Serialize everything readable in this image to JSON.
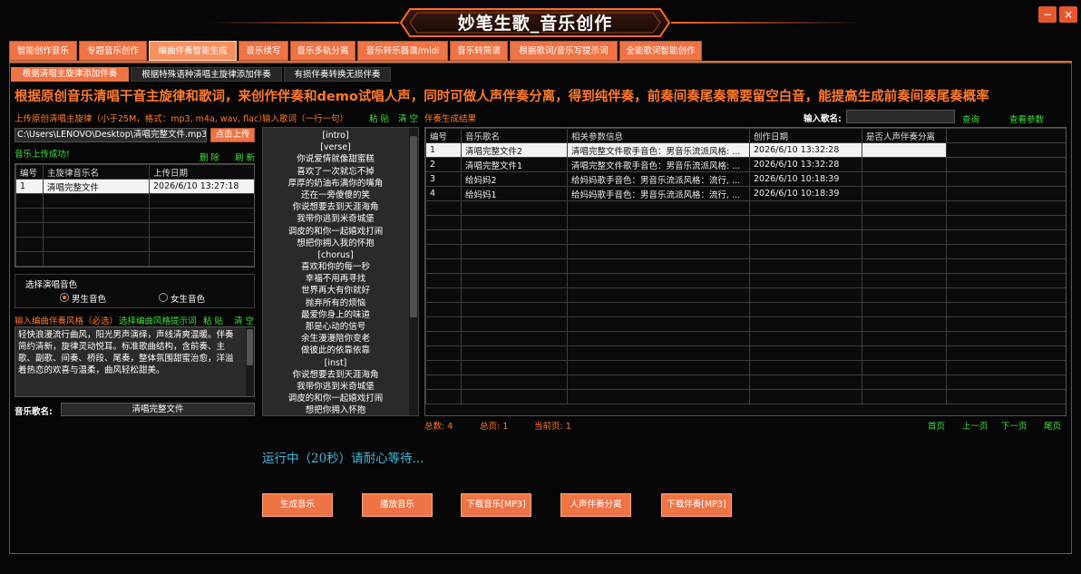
{
  "window": {
    "title": "妙笔生歌_音乐创作",
    "minimize": "−",
    "close": "×"
  },
  "tabs": [
    "智能创作音乐",
    "专题音乐创作",
    "编曲伴奏智能生成",
    "音乐续写",
    "音乐多轨分离",
    "音乐转乐器谱/midi",
    "音乐转简谱",
    "根据歌词/音乐写提示词",
    "全能歌词智能创作"
  ],
  "subtabs": [
    "根据清唱主旋律添加伴奏",
    "根据特殊语种清唱主旋律添加伴奏",
    "有损伴奏转换无损伴奏"
  ],
  "headline": "根据原创音乐清唱干音主旋律和歌词，来创作伴奏和demo试唱人声，同时可做人声伴奏分离，得到纯伴奏，前奏间奏尾奏需要留空白音，能提高生成前奏间奏尾奏概率",
  "upload": {
    "label": "上传原创清唱主旋律（小于25M，格式：mp3, m4a, wav, flac）",
    "path": "C:\\Users\\LENOVO\\Desktop\\清唱完整文件.mp3",
    "button": "点击上传",
    "success": "音乐上传成功!",
    "delete": "删 除",
    "refresh": "刷 新"
  },
  "upload_table": {
    "headers": [
      "编号",
      "主旋律音乐名",
      "上传日期"
    ],
    "rows": [
      [
        "1",
        "清唱完整文件",
        "2026/6/10 13:27:18"
      ]
    ]
  },
  "voice": {
    "title": "选择演唱音色",
    "male": "男生音色",
    "female": "女生音色",
    "selected": "male"
  },
  "style": {
    "label": "输入编曲伴奏风格（必选）",
    "hint": "选择编曲风格提示词",
    "paste": "粘 贴",
    "clear": "清 空",
    "text": "轻快浪漫流行曲风，阳光男声演绎，声线清爽温暖。伴奏简约清新，旋律灵动悦耳。标准歌曲结构，含前奏、主歌、副歌、间奏、桥段、尾奏，整体氛围甜蜜治愈，洋溢着热恋的欢喜与温柔，曲风轻松甜美。"
  },
  "song_name": {
    "label": "音乐歌名:",
    "value": "清唱完整文件"
  },
  "lyrics": {
    "label": "输入歌词（一行一句）",
    "paste": "粘 贴",
    "clear": "清 空",
    "lines": [
      "[intro]",
      "[verse]",
      "你说爱情就像甜蜜糕",
      "喜欢了一次就忘不掉",
      "厚厚的奶油布满你的嘴角",
      "还在一旁傻傻的笑",
      "你说想要去到天涯海角",
      "我带你逃到米奇城堡",
      "调皮的和你一起嬉戏打闹",
      "想把你拥入我的怀抱",
      "[chorus]",
      "喜欢和你的每一秒",
      "幸福不用再寻找",
      "世界再大有你就好",
      "抛弃所有的烦恼",
      "最爱你身上的味道",
      "那是心动的信号",
      "余生漫漫陪你变老",
      "做彼此的依靠依靠",
      "[inst]",
      "你说想要去到天涯海角",
      "我带你逃到米奇城堡",
      "调皮的和你一起嬉戏打闹",
      "想把你拥入怀抱"
    ]
  },
  "results": {
    "label": "伴奏生成结果",
    "search_label": "输入歌名:",
    "search_value": "",
    "query": "查询",
    "view_params": "查看参数",
    "headers": [
      "编号",
      "音乐歌名",
      "相关参数信息",
      "创作日期",
      "是否人声伴奏分离"
    ],
    "rows": [
      [
        "1",
        "清唱完整文件2",
        "清唱完整文件歌手音色：男音乐流派风格: ...",
        "2026/6/10 13:32:28",
        ""
      ],
      [
        "2",
        "清唱完整文件1",
        "清唱完整文件歌手音色：男音乐流派风格: ...",
        "2026/6/10 13:32:28",
        ""
      ],
      [
        "3",
        "给妈妈2",
        "给妈妈歌手音色：男音乐流派风格：流行, ...",
        "2026/6/10 10:18:39",
        ""
      ],
      [
        "4",
        "给妈妈1",
        "给妈妈歌手音色：男音乐流派风格：流行, ...",
        "2026/6/10 10:18:39",
        ""
      ]
    ],
    "selected_row": 0,
    "total": "总数: 4",
    "pages": "总页: 1",
    "current": "当前页: 1",
    "first": "首页",
    "prev": "上一页",
    "next": "下一页",
    "last": "尾页"
  },
  "status": "运行中（20秒）请耐心等待...",
  "actions": [
    "生成音乐",
    "播放音乐",
    "下载音乐[MP3]",
    "人声伴奏分离",
    "下载伴奏[MP3]"
  ]
}
